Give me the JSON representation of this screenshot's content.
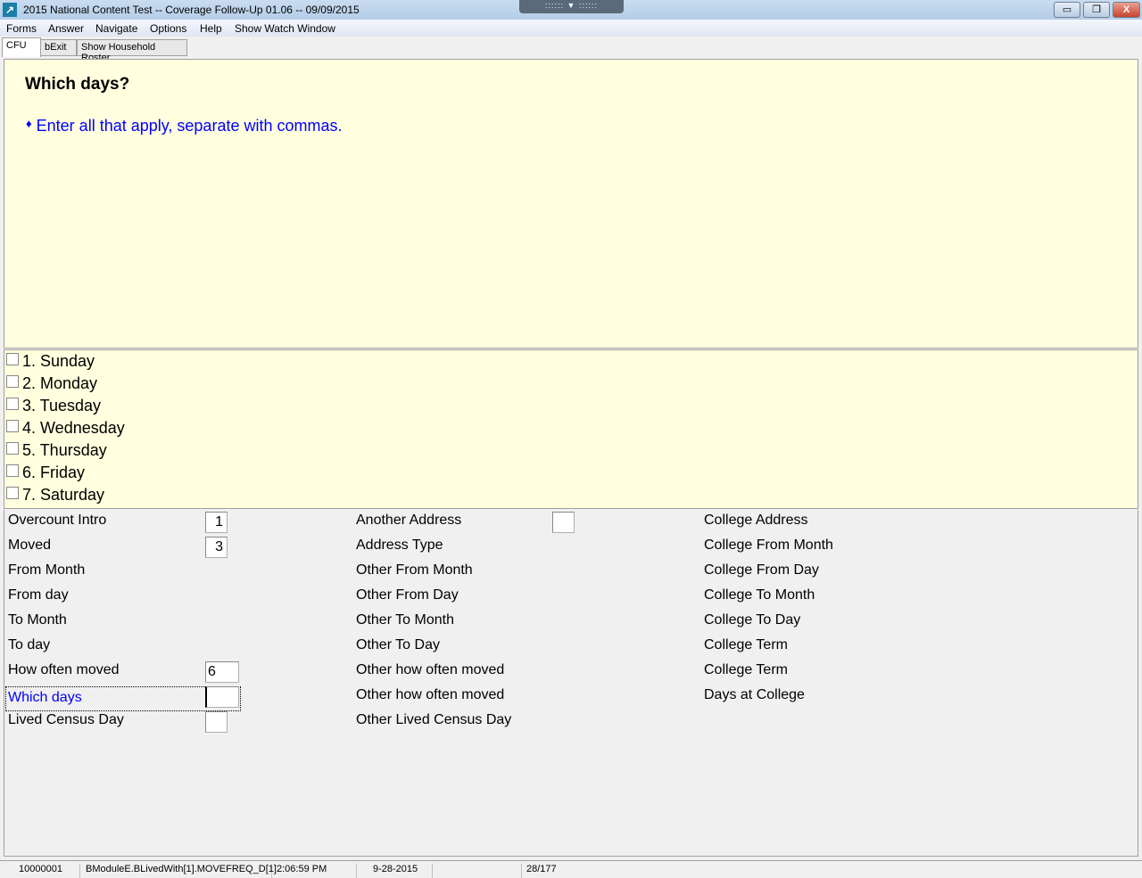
{
  "window": {
    "title": "2015 National Content Test -- Coverage Follow-Up 01.06 -- 09/09/2015",
    "buttons": {
      "minimize": "▭",
      "restore": "❐",
      "close": "X"
    }
  },
  "menu": [
    "Forms",
    "Answer",
    "Navigate",
    "Options",
    "Help",
    "Show Watch Window"
  ],
  "tabs": [
    "CFU",
    "bExit",
    "Show Household Roster"
  ],
  "question": {
    "title": "Which days?",
    "instruction": "Enter all that apply, separate with commas.",
    "bullet": "♦"
  },
  "options": [
    "1. Sunday",
    "2. Monday",
    "3. Tuesday",
    "4. Wednesday",
    "5. Thursday",
    "6. Friday",
    "7. Saturday"
  ],
  "fields": {
    "col1": [
      {
        "label": "Overcount Intro",
        "value": "1",
        "box": true
      },
      {
        "label": "Moved",
        "value": "3",
        "box": true
      },
      {
        "label": "From Month"
      },
      {
        "label": "From day"
      },
      {
        "label": "To Month"
      },
      {
        "label": "To day"
      },
      {
        "label": "How often moved",
        "value": "6",
        "box": "wide"
      },
      {
        "label": "Which days",
        "value": "",
        "box": "wide",
        "current": true
      },
      {
        "label": "Lived Census Day",
        "value": "",
        "box": true
      }
    ],
    "col2": [
      {
        "label": "Another Address",
        "value": "",
        "box": true
      },
      {
        "label": "Address Type"
      },
      {
        "label": "Other From Month"
      },
      {
        "label": "Other From Day"
      },
      {
        "label": "Other To Month"
      },
      {
        "label": "Other To Day"
      },
      {
        "label": "Other how often moved"
      },
      {
        "label": "Other how often moved"
      },
      {
        "label": "Other Lived Census Day"
      }
    ],
    "col3": [
      {
        "label": "College Address"
      },
      {
        "label": "College From Month"
      },
      {
        "label": "College From Day"
      },
      {
        "label": "College To Month"
      },
      {
        "label": "College To Day"
      },
      {
        "label": "College Term"
      },
      {
        "label": "College Term"
      },
      {
        "label": "Days at College"
      }
    ]
  },
  "status": {
    "id": "10000001",
    "field": "BModuleE.BLivedWith[1].MOVEFREQ_D[1]",
    "time": "2:06:59 PM",
    "date": "9-28-2015",
    "blank": "",
    "page": "28/177"
  },
  "colors": {
    "question_bg": "#ffffdf",
    "instruction": "#0000ff",
    "current_field": "#0000ff"
  }
}
